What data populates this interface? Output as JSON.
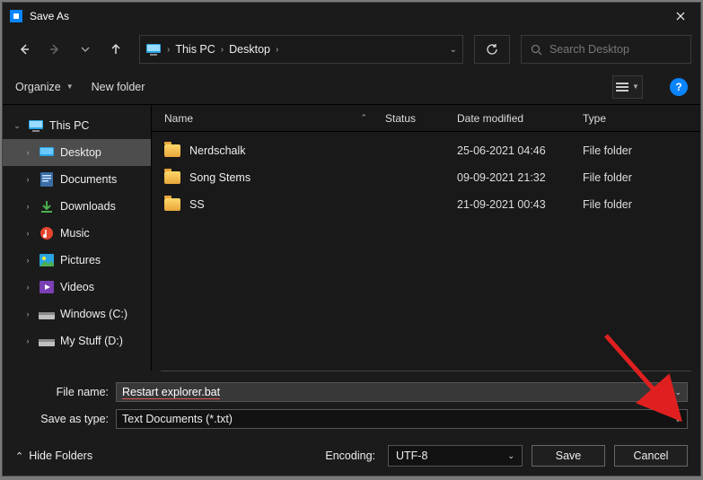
{
  "window": {
    "title": "Save As"
  },
  "nav": {
    "breadcrumb": {
      "root": "This PC",
      "leaf": "Desktop"
    },
    "search_placeholder": "Search Desktop"
  },
  "toolbar": {
    "organize": "Organize",
    "new_folder": "New folder"
  },
  "sidebar": {
    "root": "This PC",
    "items": [
      {
        "label": "Desktop"
      },
      {
        "label": "Documents"
      },
      {
        "label": "Downloads"
      },
      {
        "label": "Music"
      },
      {
        "label": "Pictures"
      },
      {
        "label": "Videos"
      },
      {
        "label": "Windows (C:)"
      },
      {
        "label": "My Stuff (D:)"
      }
    ]
  },
  "columns": {
    "name": "Name",
    "status": "Status",
    "date": "Date modified",
    "type": "Type"
  },
  "files": [
    {
      "name": "Nerdschalk",
      "date": "25-06-2021 04:46",
      "type": "File folder"
    },
    {
      "name": "Song Stems",
      "date": "09-09-2021 21:32",
      "type": "File folder"
    },
    {
      "name": "SS",
      "date": "21-09-2021 00:43",
      "type": "File folder"
    }
  ],
  "form": {
    "file_name_label": "File name:",
    "file_name_value": "Restart explorer.bat",
    "save_type_label": "Save as type:",
    "save_type_value": "Text Documents (*.txt)"
  },
  "footer": {
    "hide_folders": "Hide Folders",
    "encoding_label": "Encoding:",
    "encoding_value": "UTF-8",
    "save": "Save",
    "cancel": "Cancel"
  }
}
